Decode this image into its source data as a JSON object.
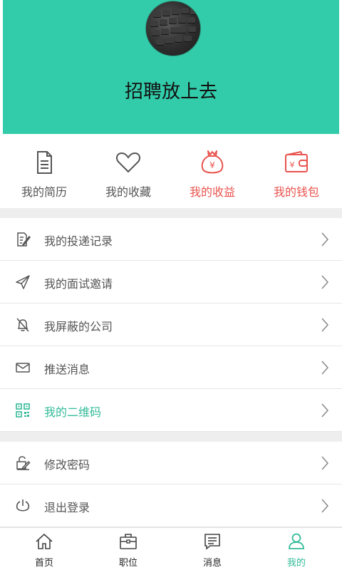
{
  "header": {
    "title": "招聘放上去",
    "bg_color": "#33ccaa"
  },
  "quick_actions": [
    {
      "label": "我的简历",
      "icon": "document-icon",
      "color": "#555555"
    },
    {
      "label": "我的收藏",
      "icon": "heart-icon",
      "color": "#555555"
    },
    {
      "label": "我的收益",
      "icon": "money-bag-icon",
      "color": "#e8544e"
    },
    {
      "label": "我的钱包",
      "icon": "wallet-icon",
      "color": "#e8544e"
    }
  ],
  "menu_group_1": [
    {
      "label": "我的投递记录",
      "icon": "edit-document-icon"
    },
    {
      "label": "我的面试邀请",
      "icon": "send-icon"
    },
    {
      "label": "我屏蔽的公司",
      "icon": "bell-off-icon"
    },
    {
      "label": "推送消息",
      "icon": "mail-icon"
    },
    {
      "label": "我的二维码",
      "icon": "qr-code-icon",
      "color": "#33bb99"
    }
  ],
  "menu_group_2": [
    {
      "label": "修改密码",
      "icon": "edit-lock-icon"
    },
    {
      "label": "退出登录",
      "icon": "power-icon"
    }
  ],
  "tabbar": {
    "items": [
      {
        "label": "首页",
        "icon": "home-icon"
      },
      {
        "label": "职位",
        "icon": "briefcase-icon"
      },
      {
        "label": "消息",
        "icon": "message-icon"
      },
      {
        "label": "我的",
        "icon": "user-icon",
        "active": true
      }
    ],
    "active_color": "#33bb99"
  }
}
